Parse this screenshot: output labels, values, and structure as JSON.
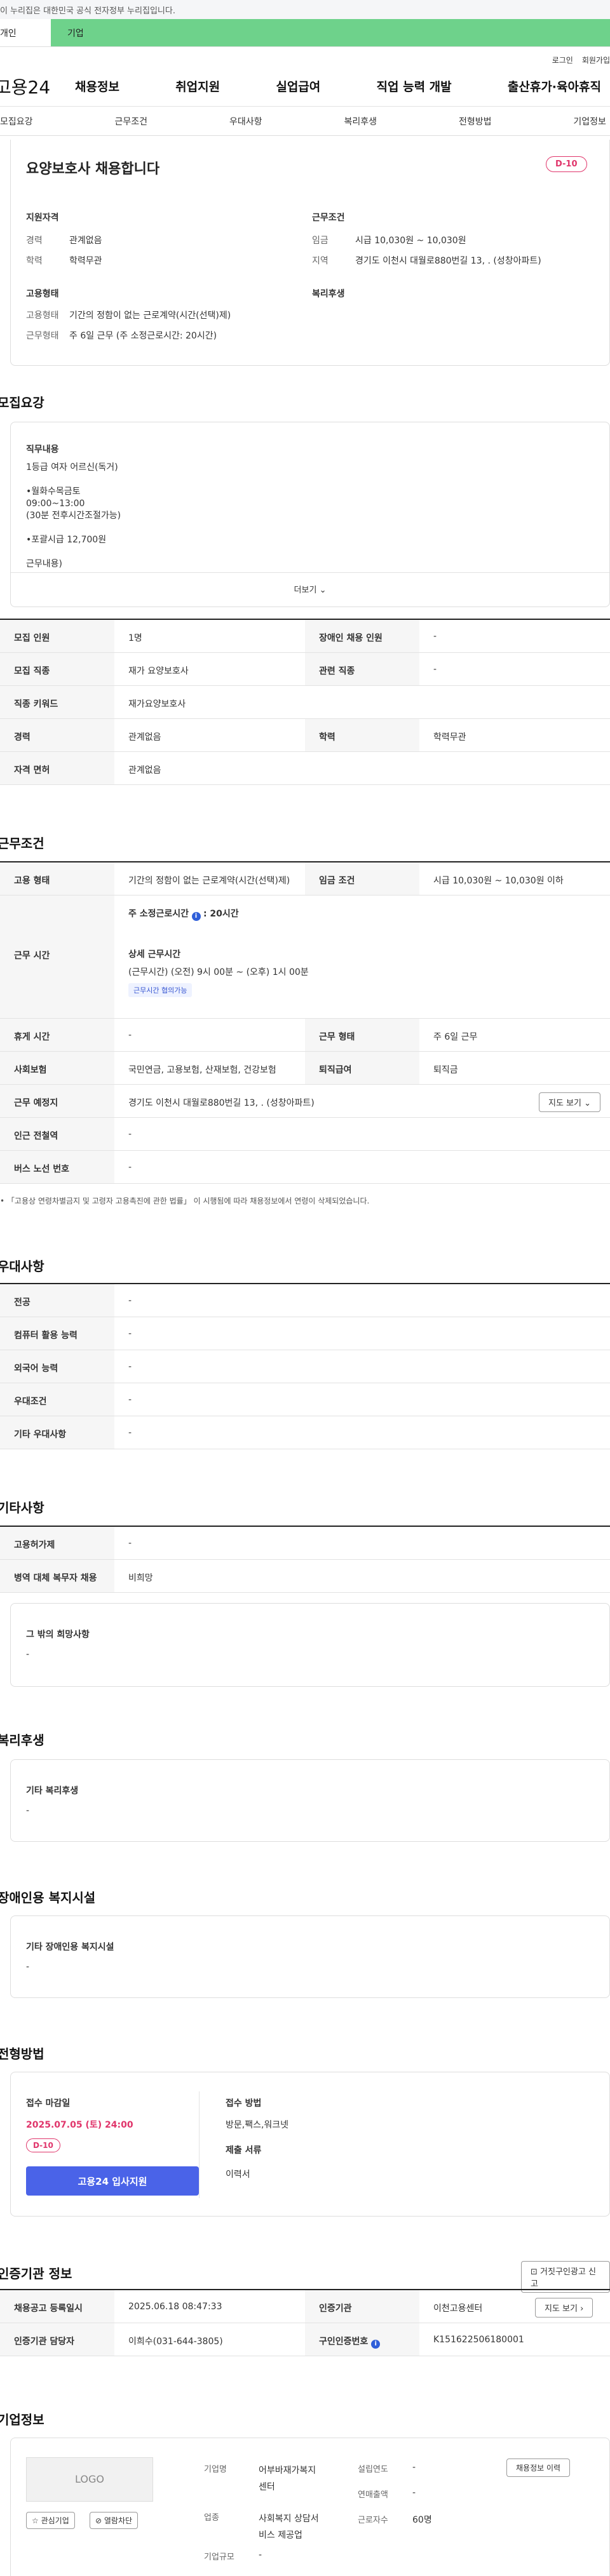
{
  "gov_banner": "이 누리집은 대한민국 공식 전자정부 누리집입니다.",
  "tabs": [
    "개인",
    "기업"
  ],
  "util": [
    "로그인",
    "회원가입"
  ],
  "logo": "고용24",
  "gnb": [
    "채용정보",
    "취업지원",
    "실업급여",
    "직업 능력 개발",
    "출산휴가·육아휴직"
  ],
  "snb": [
    "모집요강",
    "근무조건",
    "우대사항",
    "복리후생",
    "전형방법",
    "기업정보"
  ],
  "job": {
    "title": "요양보호사 채용합니다",
    "dday": "D-10",
    "qual_title": "지원자격",
    "cond_title": "근무조건",
    "form_title": "고용형태",
    "welfare_title": "복리후생",
    "career_l": "경력",
    "career_v": "관계없음",
    "edu_l": "학력",
    "edu_v": "학력무관",
    "wage_l": "임금",
    "wage_v": "시급 10,030원 ~ 10,030원",
    "area_l": "지역",
    "area_v": "경기도 이천시 대월로880번길 13, . (성창아파트)",
    "etype_l": "고용형태",
    "etype_v": "기간의 정함이 없는 근로계약(시간(선택)제)",
    "wform_l": "근무형태",
    "wform_v": "주 6일 근무 (주 소정근로시간: 20시간)"
  },
  "recruit": {
    "title": "모집요강",
    "duty_title": "직무내용",
    "duty_lines": [
      "1등급 여자 어르신(독거)",
      "",
      "•월화수목금토",
      "09:00~13:00",
      "(30분 전후시간조절가능)",
      "",
      "•포괄시급 12,700원",
      "",
      "근무내용)"
    ],
    "more": "더보기",
    "rows": [
      [
        "모집 인원",
        "1명",
        "장애인 채용 인원",
        "-"
      ],
      [
        "모집 직종",
        "재가 요양보호사",
        "관련 직종",
        "-"
      ],
      [
        "직종 키워드",
        "재가요양보호사"
      ],
      [
        "경력",
        "관계없음",
        "학력",
        "학력무관"
      ],
      [
        "자격 면허",
        "관계없음"
      ]
    ]
  },
  "work": {
    "title": "근무조건",
    "etype_l": "고용 형태",
    "etype_v": "기간의 정함이 없는 근로계약(시간(선택)제)",
    "wage_l": "임금 조건",
    "wage_v": "시급 10,030원 ~ 10,030원 이하",
    "time_l": "근무 시간",
    "week_hours_l": "주 소정근로시간",
    "week_hours_v": ": 20시간",
    "detail_l": "상세 근무시간",
    "detail_v": "(근무시간) (오전) 9시 00분 ~ (오후) 1시 00분",
    "adjust_tag": "근무시간 협의가능",
    "rest_l": "휴게 시간",
    "rest_v": "-",
    "form_l": "근무 형태",
    "form_v": "주 6일 근무",
    "ins_l": "사회보험",
    "ins_v": "국민연금, 고용보험, 산재보험, 건강보험",
    "retire_l": "퇴직급여",
    "retire_v": "퇴직금",
    "place_l": "근무 예정지",
    "place_v": "경기도 이천시 대월로880번길 13, . (성창아파트)",
    "map_btn": "지도 보기",
    "subway_l": "인근 전철역",
    "subway_v": "-",
    "bus_l": "버스 노선 번호",
    "bus_v": "-",
    "note": "「고용상 연령차별금지 및 고령자 고용촉진에 관한 법률」 이 시행됨에 따라 채용정보에서 연령이 삭제되었습니다."
  },
  "prefer": {
    "title": "우대사항",
    "rows": [
      [
        "전공",
        "-"
      ],
      [
        "컴퓨터 활용 능력",
        "-"
      ],
      [
        "외국어 능력",
        "-"
      ],
      [
        "우대조건",
        "-"
      ],
      [
        "기타 우대사항",
        "-"
      ]
    ]
  },
  "etc": {
    "title": "기타사항",
    "rows": [
      [
        "고용허가제",
        "-"
      ],
      [
        "병역 대체 복무자 채용",
        "비희망"
      ]
    ],
    "other_title": "그 밖의 희망사항",
    "other_v": "-"
  },
  "welfare": {
    "title": "복리후생",
    "box_title": "기타 복리후생",
    "box_v": "-"
  },
  "disab": {
    "title": "장애인용 복지시설",
    "box_title": "기타 장애인용 복지시설",
    "box_v": "-"
  },
  "screen": {
    "title": "전형방법",
    "deadline_l": "접수 마감일",
    "deadline_v": "2025.07.05 (토) 24:00",
    "dday": "D-10",
    "apply_btn": "고용24 입사지원",
    "method_l": "접수 방법",
    "method_v": "방문,팩스,워크넷",
    "doc_l": "제출 서류",
    "doc_v": "이력서"
  },
  "cert": {
    "title": "인증기관 정보",
    "report_btn": "거짓구인광고 신고",
    "reg_l": "채용공고 등록일시",
    "reg_v": "2025.06.18 08:47:33",
    "org_l": "인증기관",
    "org_v": "이천고용센터",
    "map_btn": "지도 보기",
    "mgr_l": "인증기관 담당자",
    "mgr_v": "이희수(031-644-3805)",
    "no_l": "구인인증번호",
    "no_v": "K151622506180001"
  },
  "company": {
    "title": "기업정보",
    "logo": "LOGO",
    "fav_btn": "관심기업",
    "block_btn": "열람차단",
    "hist_btn": "채용정보 이력",
    "name_l": "기업명",
    "name_v": "어부바재가복지센터",
    "biz_l": "업종",
    "biz_v": "사회복지 상담서비스 제공업",
    "scale_l": "기업규모",
    "scale_v": "-",
    "est_l": "설립연도",
    "est_v": "-",
    "sales_l": "연매출액",
    "sales_v": "-",
    "emp_l": "근로자수",
    "emp_v": "60명"
  },
  "colors": {
    "accent_green": "#6ed28b",
    "dday_red": "#e0356b",
    "apply_blue": "#4a63e8"
  }
}
